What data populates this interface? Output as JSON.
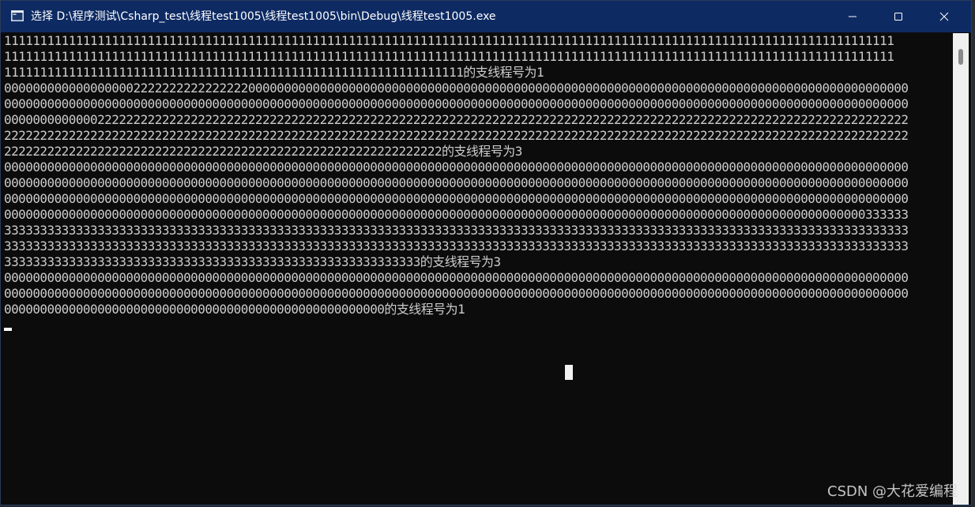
{
  "window": {
    "title": "选择 D:\\程序测试\\Csharp_test\\线程test1005\\线程test1005\\bin\\Debug\\线程test1005.exe",
    "icon": "console-app-icon"
  },
  "titlebar_buttons": {
    "minimize_icon": "minimize-icon",
    "maximize_icon": "maximize-icon",
    "close_icon": "close-icon"
  },
  "console": {
    "lines": [
      "1111111111111111111111111111111111111111111111111111111111111111111111111111111111111111111111111111111111111111111111111111",
      "1111111111111111111111111111111111111111111111111111111111111111111111111111111111111111111111111111111111111111111111111111",
      "1111111111111111111111111111111111111111111111111111111111111111的支线程号为1",
      "000000000000000000222222222222222200000000000000000000000000000000000000000000000000000000000000000000000000000000000000000000",
      "000000000000000000000000000000000000000000000000000000000000000000000000000000000000000000000000000000000000000000000000000000",
      "000000000000022222222222222222222222222222222222222222222222222222222222222222222222222222222222222222222222222222222222222222",
      "222222222222222222222222222222222222222222222222222222222222222222222222222222222222222222222222222222222222222222222222222222",
      "2222222222222222222222222222222222222222222222222222222222222的支线程号为3",
      "000000000000000000000000000000000000000000000000000000000000000000000000000000000000000000000000000000000000000000000000000000",
      "000000000000000000000000000000000000000000000000000000000000000000000000000000000000000000000000000000000000000000000000000000",
      "000000000000000000000000000000000000000000000000000000000000000000000000000000000000000000000000000000000000000000000000000000",
      "000000000000000000000000000000000000000000000000000000000000000000000000000000000000000000000000000000000000000000000000333333",
      "333333333333333333333333333333333333333333333333333333333333333333333333333333333333333333333333333333333333333333333333333333",
      "333333333333333333333333333333333333333333333333333333333333333333333333333333333333333333333333333333333333333333333333333333",
      "3333333333333333333333333333333333333333333333333333333333的支线程号为3",
      "000000000000000000000000000000000000000000000000000000000000000000000000000000000000000000000000000000000000000000000000000000",
      "000000000000000000000000000000000000000000000000000000000000000000000000000000000000000000000000000000000000000000000000000000",
      "00000000000000000000000000000000000000000000000000000的支线程号为1"
    ]
  },
  "watermark": "CSDN @大花爱编程"
}
